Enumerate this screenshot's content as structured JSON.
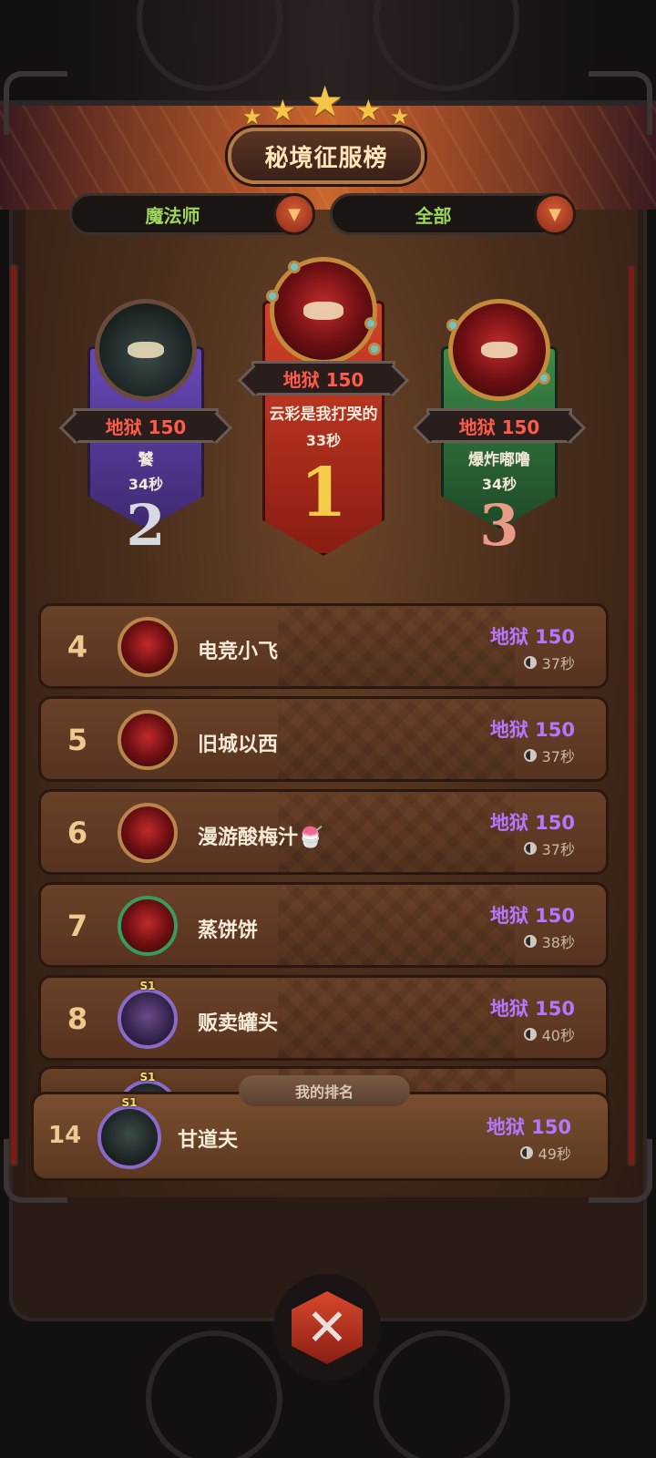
{
  "header": {
    "title": "秘境征服榜",
    "stars": 5
  },
  "filters": {
    "class_label": "魔法师",
    "scope_label": "全部"
  },
  "podium": [
    {
      "rank": "1",
      "difficulty": "地狱 150",
      "name": "云彩是我打哭的",
      "time": "33秒"
    },
    {
      "rank": "2",
      "difficulty": "地狱 150",
      "name": "饕",
      "time": "34秒"
    },
    {
      "rank": "3",
      "difficulty": "地狱 150",
      "name": "爆炸嘟噜",
      "time": "34秒"
    }
  ],
  "list": [
    {
      "rank": "4",
      "name": "电竞小飞",
      "difficulty": "地狱 150",
      "time": "37秒"
    },
    {
      "rank": "5",
      "name": "旧城以西",
      "difficulty": "地狱 150",
      "time": "37秒"
    },
    {
      "rank": "6",
      "name": "漫游酸梅汁🍧",
      "difficulty": "地狱 150",
      "time": "37秒"
    },
    {
      "rank": "7",
      "name": "蒸饼饼",
      "difficulty": "地狱 150",
      "time": "38秒"
    },
    {
      "rank": "8",
      "name": "贩卖罐头",
      "difficulty": "地狱 150",
      "time": "40秒",
      "badge": "S1"
    }
  ],
  "partial_row_badge": "S1",
  "my_rank": {
    "label": "我的排名",
    "rank": "14",
    "name": "甘道夫",
    "difficulty": "地狱 150",
    "time": "49秒",
    "badge": "S1"
  },
  "colors": {
    "difficulty_podium": "#ff5a4a",
    "difficulty_list": "#b676ff",
    "filter_text": "#9ed85a"
  }
}
